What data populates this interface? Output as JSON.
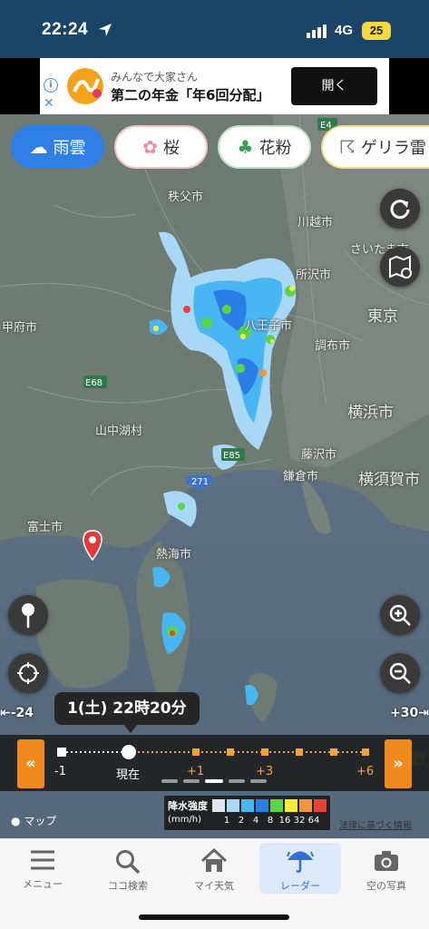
{
  "status_bar": {
    "time": "22:24",
    "network": "4G",
    "battery": "25"
  },
  "ad": {
    "line1": "みんなで大家さん",
    "line2": "第二の年金「年6回分配」",
    "button": "開く"
  },
  "chips": [
    {
      "label": "雨雲",
      "icon": "rain-cloud-icon",
      "active": true
    },
    {
      "label": "桜",
      "icon": "cherry-blossom-icon",
      "active": false
    },
    {
      "label": "花粉",
      "icon": "tree-icon",
      "active": false
    },
    {
      "label": "ゲリラ雷",
      "icon": "thunder-cloud-icon",
      "active": false
    }
  ],
  "map": {
    "places": [
      "秩父市",
      "川越市",
      "さいたま市",
      "所沢市",
      "東京",
      "甲府市",
      "八王子市",
      "調布市",
      "横浜市",
      "山中湖村",
      "藤沢市",
      "鎌倉市",
      "横須賀市",
      "富士市",
      "熱海市"
    ],
    "road_signs": [
      "E4",
      "E68",
      "E85",
      "271"
    ],
    "credit": "マップ"
  },
  "timeline": {
    "bubble": "1(土) 22時20分",
    "left_edge": "-24",
    "right_edge": "+30",
    "labels": [
      "-1",
      "現在",
      "+1",
      "+3",
      "+6"
    ]
  },
  "legend": {
    "title": "降水強度",
    "unit": "(mm/h)",
    "values": [
      "1",
      "2",
      "4",
      "8",
      "16",
      "32",
      "64"
    ],
    "colors": [
      "#dfe6f0",
      "#a8d8f6",
      "#48b6f2",
      "#2a7ee6",
      "#5ad645",
      "#f6ec3c",
      "#f0963e",
      "#e64238"
    ]
  },
  "law_link": "法律に基づく情報",
  "tabs": [
    {
      "label": "メニュー",
      "icon": "menu-icon",
      "active": false
    },
    {
      "label": "ココ検索",
      "icon": "search-icon",
      "active": false
    },
    {
      "label": "マイ天気",
      "icon": "home-icon",
      "active": false
    },
    {
      "label": "レーダー",
      "icon": "umbrella-icon",
      "active": true
    },
    {
      "label": "空の写真",
      "icon": "camera-icon",
      "active": false
    }
  ]
}
